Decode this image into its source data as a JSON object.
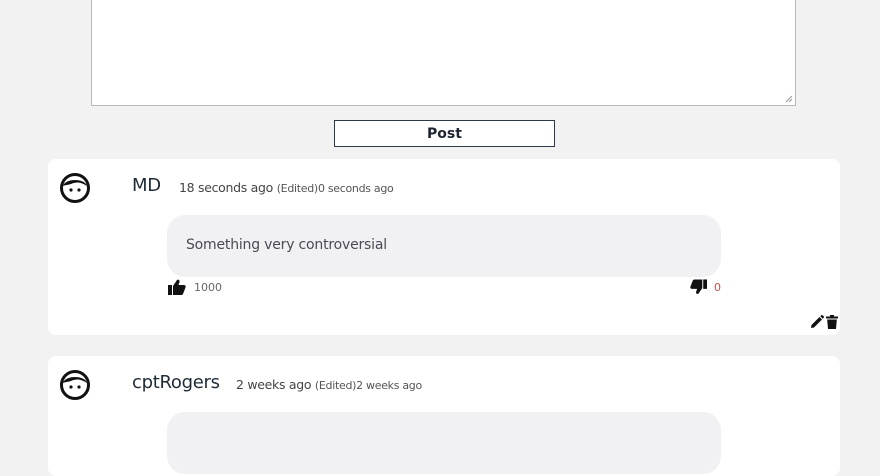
{
  "composer": {
    "text": ""
  },
  "post_button": {
    "label": "Post"
  },
  "comments": [
    {
      "username": "MD",
      "posted": "18 seconds ago",
      "edited_label": "(Edited)",
      "edited_time": "0 seconds ago",
      "text": "Something very controversial",
      "likes": "1000",
      "dislikes": "0"
    },
    {
      "username": "cptRogers",
      "posted": "2 weeks ago",
      "edited_label": "(Edited)",
      "edited_time": "2 weeks ago"
    }
  ],
  "icons": {
    "avatar": "face-icon",
    "like": "thumbs-up-icon",
    "dislike": "thumbs-down-icon",
    "edit": "pencil-icon",
    "delete": "trash-icon"
  },
  "colors": {
    "background": "#f2f2f2",
    "card": "#ffffff",
    "bubble": "#f1f1f3",
    "dislike_count": "#c0504d",
    "button_border": "#2d3a4a"
  }
}
